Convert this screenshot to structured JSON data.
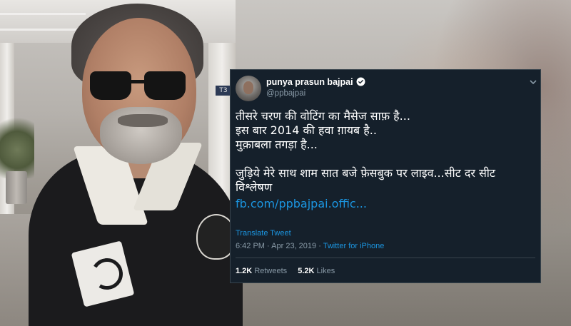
{
  "tweet": {
    "display_name": "punya prasun bajpai",
    "handle": "@ppbajpai",
    "verified": true,
    "lines": [
      "तीसरे चरण की वोटिंग का मैसेज साफ़ है...",
      "इस बार 2014 की हवा ग़ायब है..",
      "मुक़ाबला तगड़ा है..."
    ],
    "lines2": [
      "जुड़िये मेरे साथ शाम सात बजे फ़ेसबुक पर लाइव...सीट दर सीट",
      "विश्लेषण"
    ],
    "link": "fb.com/ppbajpai.offic...",
    "translate_label": "Translate Tweet",
    "time": "6:42 PM",
    "date": "Apr 23, 2019",
    "source": "Twitter for iPhone",
    "retweets_count": "1.2K",
    "retweets_label": "Retweets",
    "likes_count": "5.2K",
    "likes_label": "Likes"
  },
  "background": {
    "sign_text": "T3"
  },
  "colors": {
    "card_bg": "#15202b",
    "link": "#1b95e0",
    "muted": "#8899a6",
    "border": "#38444d"
  },
  "icons": [
    "verified-badge-icon",
    "chevron-down-icon"
  ]
}
